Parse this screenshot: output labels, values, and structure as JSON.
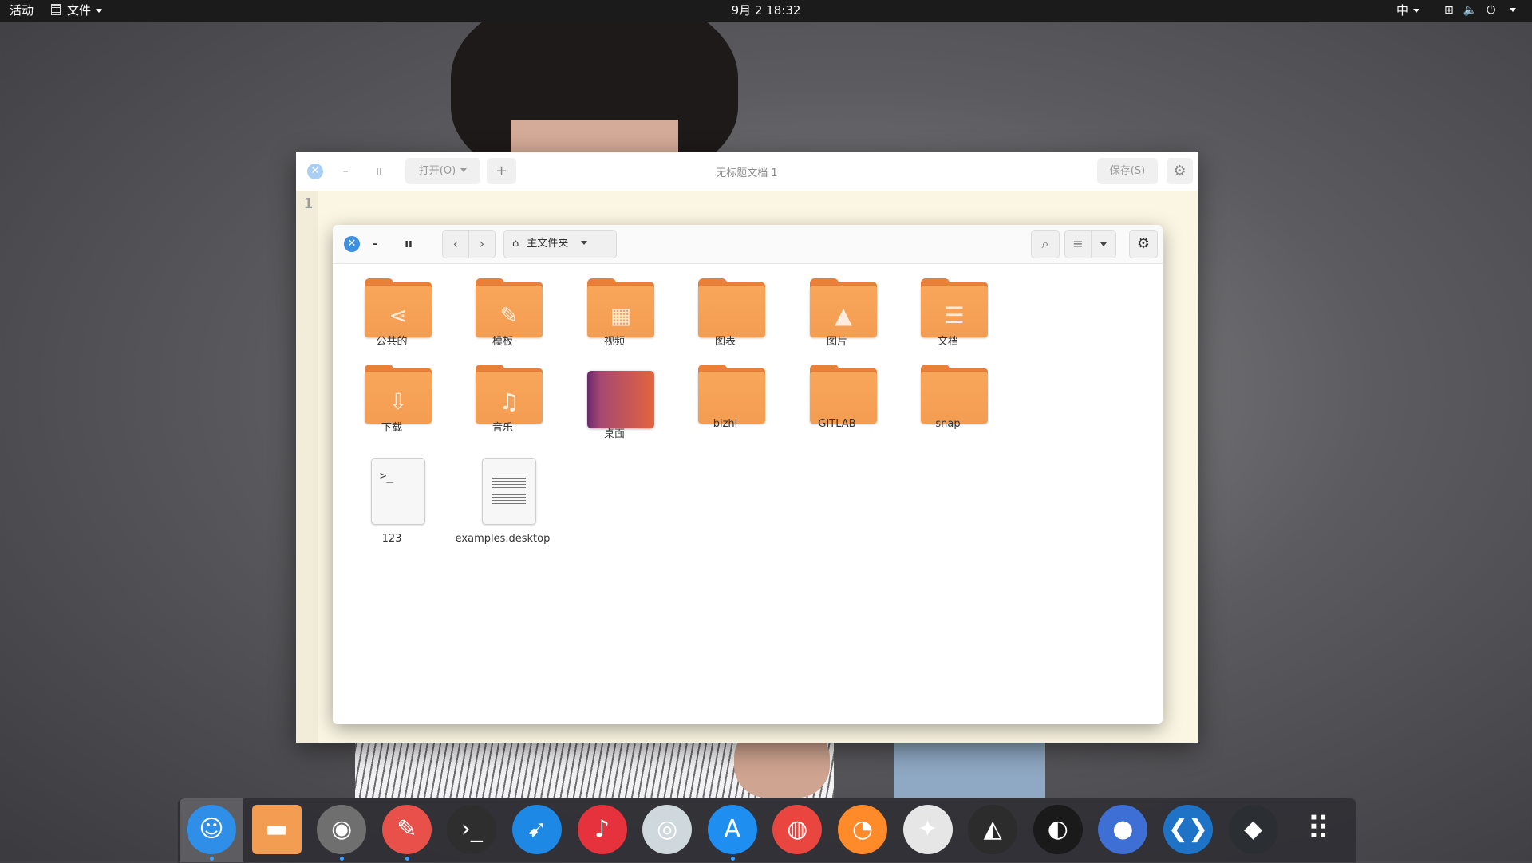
{
  "topbar": {
    "activities": "活动",
    "app_menu": "文件",
    "clock": "9月 2  18:32",
    "input_method": "中"
  },
  "editor": {
    "open_label": "打开(O)",
    "new_tab_label": "+",
    "title": "无标题文档 1",
    "save_label": "保存(S)",
    "line_number": "1"
  },
  "files": {
    "location": "主文件夹",
    "items": [
      {
        "label": "公共的",
        "kind": "folder",
        "emblem": "share-icon"
      },
      {
        "label": "模板",
        "kind": "folder",
        "emblem": "template-icon"
      },
      {
        "label": "视频",
        "kind": "folder",
        "emblem": "video-icon"
      },
      {
        "label": "图表",
        "kind": "folder",
        "emblem": "none"
      },
      {
        "label": "图片",
        "kind": "folder",
        "emblem": "picture-icon"
      },
      {
        "label": "文档",
        "kind": "folder",
        "emblem": "document-icon"
      },
      {
        "label": "下载",
        "kind": "folder",
        "emblem": "download-icon"
      },
      {
        "label": "音乐",
        "kind": "folder",
        "emblem": "music-icon"
      },
      {
        "label": "桌面",
        "kind": "desktop",
        "emblem": "none"
      },
      {
        "label": "bizhi",
        "kind": "folder",
        "emblem": "none"
      },
      {
        "label": "GITLAB",
        "kind": "folder",
        "emblem": "none"
      },
      {
        "label": "snap",
        "kind": "folder",
        "emblem": "none"
      },
      {
        "label": "123",
        "kind": "script",
        "emblem": "terminal-icon"
      },
      {
        "label": "examples.desktop",
        "kind": "text",
        "emblem": "text-file-icon"
      }
    ]
  },
  "dock": {
    "apps": [
      {
        "name": "finder",
        "color": "#2f8fe8",
        "active": true
      },
      {
        "name": "files",
        "color": "#f39d52",
        "active": false
      },
      {
        "name": "toggle",
        "color": "#6f6f6f",
        "active": true
      },
      {
        "name": "text-editor",
        "color": "#e8504a",
        "active": true
      },
      {
        "name": "terminal",
        "color": "#2e2e2e",
        "active": false
      },
      {
        "name": "safari",
        "color": "#1e88e5",
        "active": false
      },
      {
        "name": "netease-music",
        "color": "#e6323c",
        "active": false
      },
      {
        "name": "camera",
        "color": "#cfd8dc",
        "active": false
      },
      {
        "name": "app-store",
        "color": "#1e8ef0",
        "active": true
      },
      {
        "name": "chrome",
        "color": "#e9463f",
        "active": false
      },
      {
        "name": "firefox",
        "color": "#ff8a2a",
        "active": false
      },
      {
        "name": "gimp",
        "color": "#e6e6e6",
        "active": false
      },
      {
        "name": "inkscape",
        "color": "#2c2c2c",
        "active": false
      },
      {
        "name": "obs",
        "color": "#1a1a1a",
        "active": false
      },
      {
        "name": "screenshot",
        "color": "#3d6fd4",
        "active": false
      },
      {
        "name": "vscode",
        "color": "#1e73c7",
        "active": false
      },
      {
        "name": "cube-app",
        "color": "#2b2f33",
        "active": false
      },
      {
        "name": "app-grid",
        "color": "#2d2d32",
        "active": false
      }
    ]
  }
}
